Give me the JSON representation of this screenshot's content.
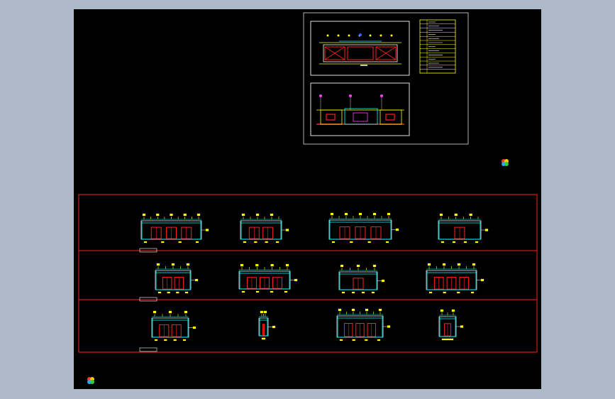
{
  "drawing": {
    "background": "#000000",
    "viewport_border": "#adb9c9",
    "frame_color": "#ff2020",
    "sheet_border_color": "#b0b0b0",
    "plan_panel_color": "#e0e0e0"
  },
  "colors": {
    "yellow": "#ffff00",
    "cyan": "#00ffff",
    "red": "#ff2020",
    "white": "#ffffff",
    "blue": "#3060ff",
    "magenta": "#ff40ff",
    "green": "#20ff40"
  },
  "logos": [
    {
      "name": "brand-logo-top",
      "icon": "pinwheel-logo-icon"
    },
    {
      "name": "brand-logo-bottom",
      "icon": "pinwheel-logo-icon"
    }
  ]
}
